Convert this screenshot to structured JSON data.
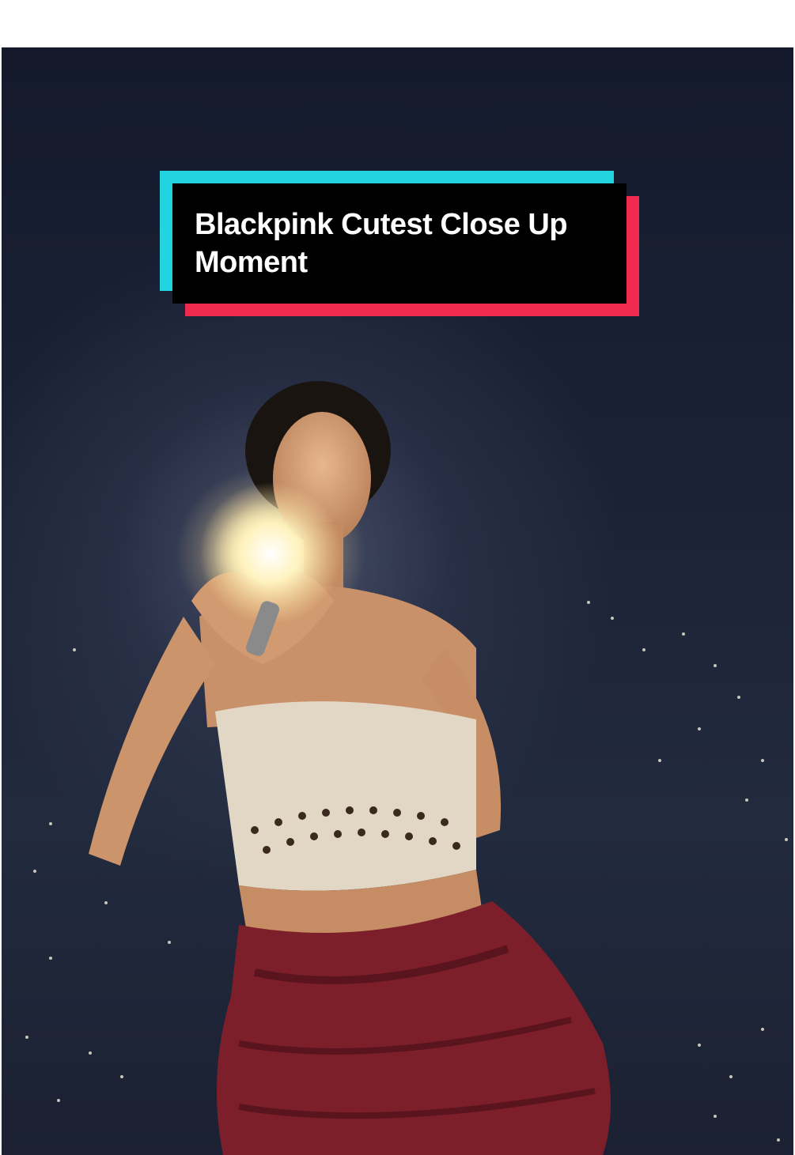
{
  "caption": {
    "text": "Blackpink Cutest Close Up Moment",
    "accent_left": "#22d3e0",
    "accent_right": "#f0294f",
    "background": "#000000"
  },
  "photo": {
    "subject": "performer-on-stage"
  }
}
